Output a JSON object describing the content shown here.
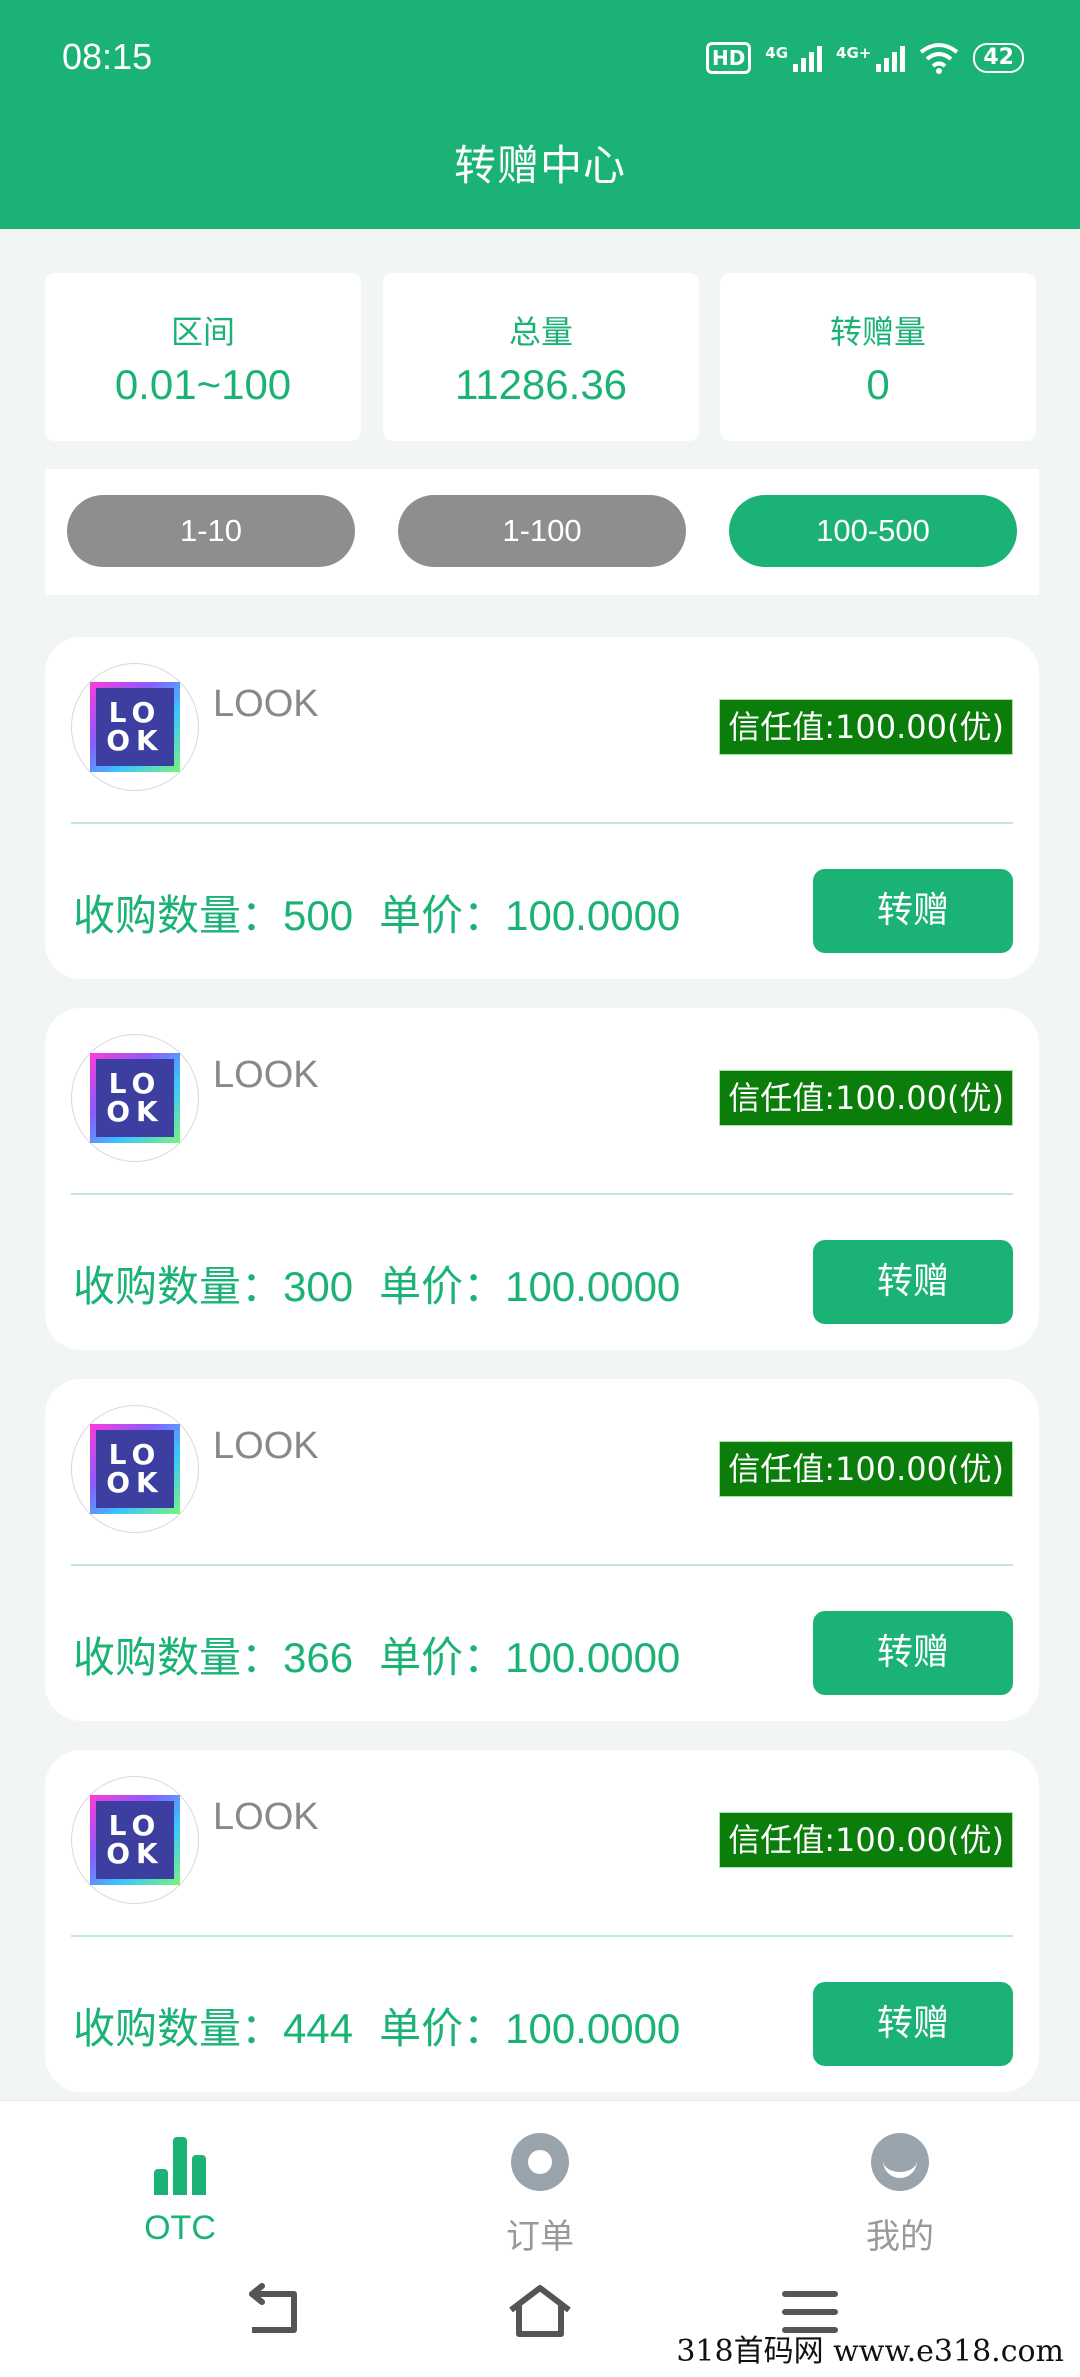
{
  "status_bar": {
    "time": "08:15",
    "hd_label": "HD",
    "signal_1_label": "4G",
    "signal_2_label": "4G+",
    "battery": "42"
  },
  "header": {
    "title": "转赠中心"
  },
  "stats": [
    {
      "label": "区间",
      "value": "0.01~100"
    },
    {
      "label": "总量",
      "value": "11286.36"
    },
    {
      "label": "转赠量",
      "value": "0"
    }
  ],
  "filters": [
    {
      "label": "1-10",
      "active": false
    },
    {
      "label": "1-100",
      "active": false
    },
    {
      "label": "100-500",
      "active": true
    }
  ],
  "colors": {
    "primary": "#1bb276",
    "inactive_pill": "#8e8e8e",
    "trust_badge": "#0a7d0a",
    "background": "#f1f6f5"
  },
  "card_labels": {
    "quantity_label": "收购数量：",
    "price_label": "单价：",
    "button_label": "转赠"
  },
  "cards": [
    {
      "logo_text": "LOOK",
      "name": "LOOK",
      "trust": "信任值:100.00(优)",
      "quantity": "500",
      "price": "100.0000"
    },
    {
      "logo_text": "LOOK",
      "name": "LOOK",
      "trust": "信任值:100.00(优)",
      "quantity": "300",
      "price": "100.0000"
    },
    {
      "logo_text": "LOOK",
      "name": "LOOK",
      "trust": "信任值:100.00(优)",
      "quantity": "366",
      "price": "100.0000"
    },
    {
      "logo_text": "LOOK",
      "name": "LOOK",
      "trust": "信任值:100.00(优)",
      "quantity": "444",
      "price": "100.0000"
    }
  ],
  "tabbar": [
    {
      "label": "OTC",
      "icon": "bar-chart-icon",
      "active": true
    },
    {
      "label": "订单",
      "icon": "order-icon",
      "active": false
    },
    {
      "label": "我的",
      "icon": "profile-icon",
      "active": false
    }
  ],
  "system_nav": [
    "back-icon",
    "home-icon",
    "menu-icon"
  ],
  "watermark": "318首码网  www.e318.com"
}
